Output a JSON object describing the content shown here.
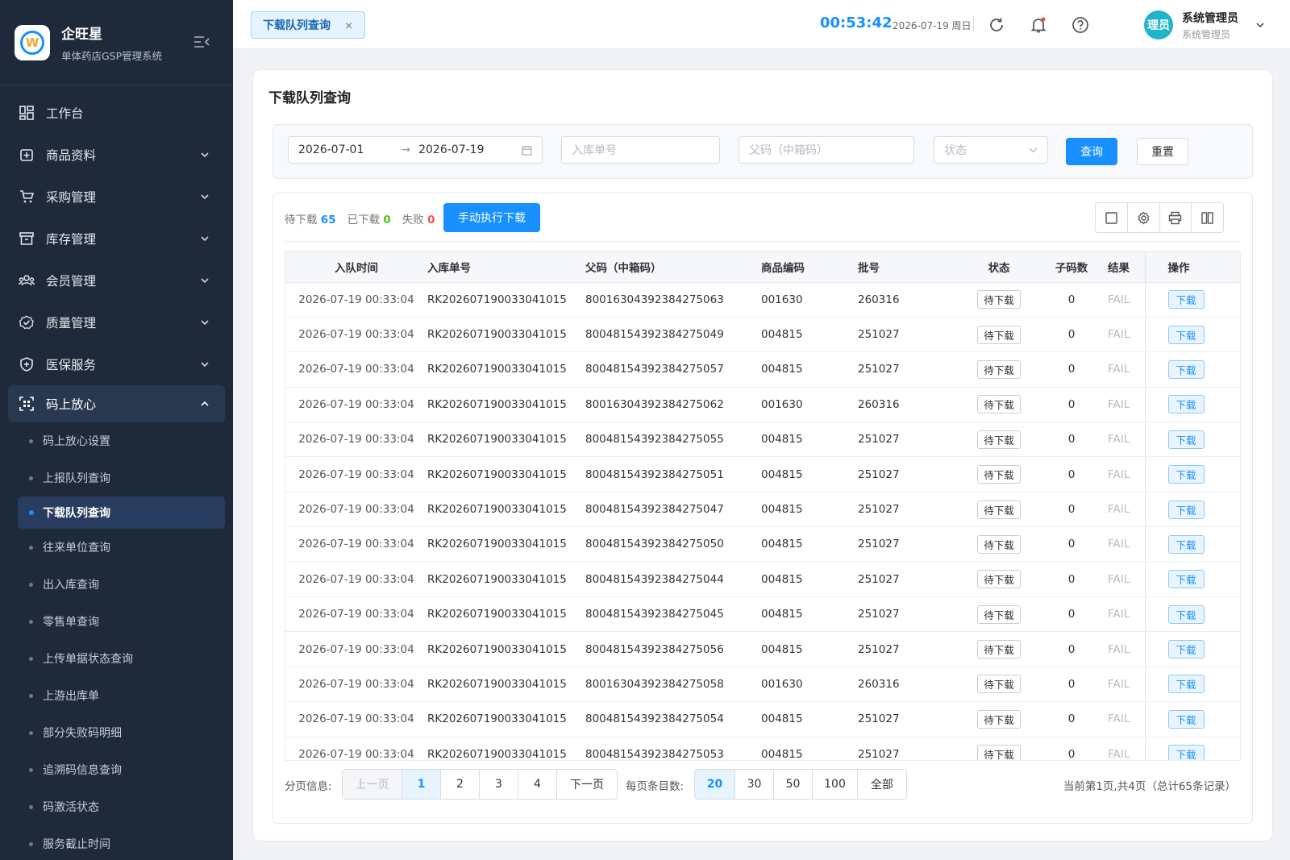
{
  "brand": {
    "name": "企旺星",
    "subtitle": "单体药店GSP管理系统"
  },
  "menu": [
    {
      "label": "工作台",
      "icon": "dashboard-icon"
    },
    {
      "label": "商品资料",
      "icon": "goods-icon"
    },
    {
      "label": "采购管理",
      "icon": "cart-icon"
    },
    {
      "label": "库存管理",
      "icon": "inventory-icon"
    },
    {
      "label": "会员管理",
      "icon": "members-icon"
    },
    {
      "label": "质量管理",
      "icon": "quality-icon"
    },
    {
      "label": "医保服务",
      "icon": "insurance-icon"
    },
    {
      "label": "码上放心",
      "icon": "qrcode-icon"
    }
  ],
  "submenu": [
    "码上放心设置",
    "上报队列查询",
    "下载队列查询",
    "往来单位查询",
    "出入库查询",
    "零售单查询",
    "上传单据状态查询",
    "上游出库单",
    "部分失败码明细",
    "追溯码信息查询",
    "码激活状态",
    "服务截止时间"
  ],
  "topbar": {
    "tab_label": "下载队列查询",
    "tab_close": "×",
    "clock": "00:53:42",
    "date": "2026-07-19 周日",
    "avatar_text": "理员",
    "user_name": "系统管理员",
    "user_role": "系统管理员"
  },
  "page": {
    "title": "下载队列查询"
  },
  "filter": {
    "date_start": "2026-07-01",
    "date_sep": "→",
    "date_end": "2026-07-19",
    "inbound_placeholder": "入库单号",
    "parent_placeholder": "父码（中箱码）",
    "status_placeholder": "状态",
    "query_label": "查询",
    "reset_label": "重置"
  },
  "stats": {
    "pending_label": "待下载",
    "pending_count": "65",
    "done_label": "已下载",
    "done_count": "0",
    "fail_label": "失败",
    "fail_count": "0",
    "manual_button": "手动执行下载"
  },
  "colors": {
    "pending": "#1890ff",
    "done": "#52c41a",
    "fail": "#ff4d4f"
  },
  "table": {
    "headers": [
      "入队时间",
      "入库单号",
      "父码（中箱码）",
      "商品编码",
      "批号",
      "状态",
      "子码数",
      "结果",
      "操作"
    ],
    "rows": [
      [
        "2026-07-19 00:33:04",
        "RK202607190033041015",
        "80016304392384275063",
        "001630",
        "260316",
        "待下载",
        "0",
        "FAIL",
        "下载"
      ],
      [
        "2026-07-19 00:33:04",
        "RK202607190033041015",
        "80048154392384275049",
        "004815",
        "251027",
        "待下载",
        "0",
        "FAIL",
        "下载"
      ],
      [
        "2026-07-19 00:33:04",
        "RK202607190033041015",
        "80048154392384275057",
        "004815",
        "251027",
        "待下载",
        "0",
        "FAIL",
        "下载"
      ],
      [
        "2026-07-19 00:33:04",
        "RK202607190033041015",
        "80016304392384275062",
        "001630",
        "260316",
        "待下载",
        "0",
        "FAIL",
        "下载"
      ],
      [
        "2026-07-19 00:33:04",
        "RK202607190033041015",
        "80048154392384275055",
        "004815",
        "251027",
        "待下载",
        "0",
        "FAIL",
        "下载"
      ],
      [
        "2026-07-19 00:33:04",
        "RK202607190033041015",
        "80048154392384275051",
        "004815",
        "251027",
        "待下载",
        "0",
        "FAIL",
        "下载"
      ],
      [
        "2026-07-19 00:33:04",
        "RK202607190033041015",
        "80048154392384275047",
        "004815",
        "251027",
        "待下载",
        "0",
        "FAIL",
        "下载"
      ],
      [
        "2026-07-19 00:33:04",
        "RK202607190033041015",
        "80048154392384275050",
        "004815",
        "251027",
        "待下载",
        "0",
        "FAIL",
        "下载"
      ],
      [
        "2026-07-19 00:33:04",
        "RK202607190033041015",
        "80048154392384275044",
        "004815",
        "251027",
        "待下载",
        "0",
        "FAIL",
        "下载"
      ],
      [
        "2026-07-19 00:33:04",
        "RK202607190033041015",
        "80048154392384275045",
        "004815",
        "251027",
        "待下载",
        "0",
        "FAIL",
        "下载"
      ],
      [
        "2026-07-19 00:33:04",
        "RK202607190033041015",
        "80048154392384275056",
        "004815",
        "251027",
        "待下载",
        "0",
        "FAIL",
        "下载"
      ],
      [
        "2026-07-19 00:33:04",
        "RK202607190033041015",
        "80016304392384275058",
        "001630",
        "260316",
        "待下载",
        "0",
        "FAIL",
        "下载"
      ],
      [
        "2026-07-19 00:33:04",
        "RK202607190033041015",
        "80048154392384275054",
        "004815",
        "251027",
        "待下载",
        "0",
        "FAIL",
        "下载"
      ],
      [
        "2026-07-19 00:33:04",
        "RK202607190033041015",
        "80048154392384275053",
        "004815",
        "251027",
        "待下载",
        "0",
        "FAIL",
        "下载"
      ]
    ]
  },
  "pager": {
    "label": "分页信息:",
    "prev": "上一页",
    "pages": [
      "1",
      "2",
      "3",
      "4"
    ],
    "next": "下一页",
    "size_label": "每页条目数:",
    "sizes": [
      "20",
      "30",
      "50",
      "100",
      "全部"
    ],
    "info": "当前第1页,共4页（总计65条记录）"
  }
}
